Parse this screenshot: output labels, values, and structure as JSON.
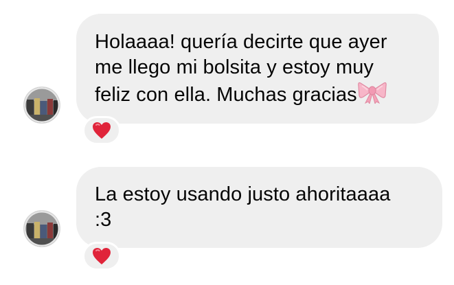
{
  "messages": [
    {
      "lines": [
        "Holaaaa! quería decirte que ayer",
        "me llego mi bolsita y estoy muy",
        "feliz con ella. Muchas gracias"
      ],
      "trailing_emoji": "ribbon-bow-icon",
      "reaction": "red-heart-icon"
    },
    {
      "lines": [
        "La estoy usando justo ahoritaaaa",
        ":3"
      ],
      "reaction": "red-heart-icon"
    }
  ],
  "colors": {
    "bubble": "#efefef",
    "text": "#050505",
    "heart": "#e0243a",
    "bow": "#f4a3b8"
  }
}
